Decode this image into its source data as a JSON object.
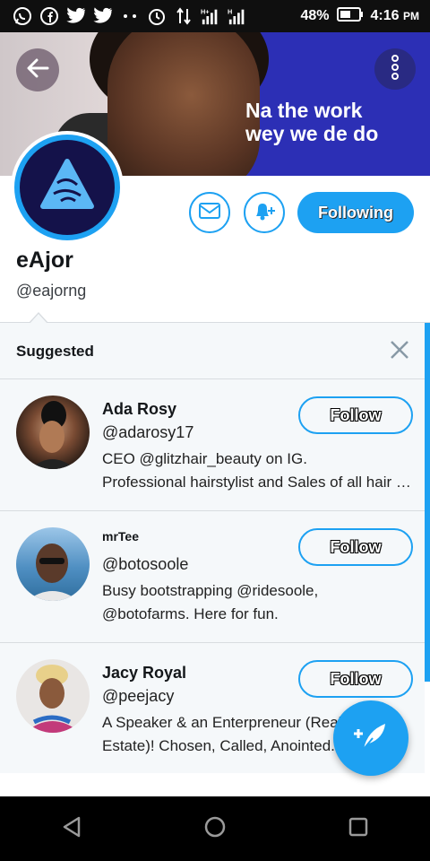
{
  "status_bar": {
    "battery": "48%",
    "time": "4:16",
    "ampm": "PM",
    "icons": [
      "whatsapp-icon",
      "facebook-icon",
      "twitter-icon",
      "twitter-icon",
      "more-dots-icon",
      "alarm-icon",
      "data-transfer-icon",
      "signal-h-icon",
      "signal-h-icon",
      "battery-icon"
    ]
  },
  "banner": {
    "ad_line1": "Na the work",
    "ad_line2": "wey we de do"
  },
  "profile": {
    "name": "eAjor",
    "handle": "@eajorng",
    "following_label": "Following"
  },
  "suggested": {
    "title": "Suggested",
    "users": [
      {
        "name": "Ada Rosy",
        "handle": "@adarosy17",
        "bio_line1": "CEO @glitzhair_beauty on IG.",
        "bio_line2": "Professional hairstylist and Sales of all hair extensions",
        "follow_label": "Follow"
      },
      {
        "name": "mrTee",
        "handle": "@botosoole",
        "bio_line1": "Busy bootstrapping @ridesoole,",
        "bio_line2": "@botofarms. Here for fun.",
        "follow_label": "Follow"
      },
      {
        "name": "Jacy Royal",
        "handle": "@peejacy",
        "bio_line1": "A Speaker & an Enterpreneur (Real",
        "bio_line2": "Estate)! Chosen, Called, Anointed...",
        "follow_label": "Follow"
      }
    ]
  },
  "accent_color": "#1da1f2"
}
